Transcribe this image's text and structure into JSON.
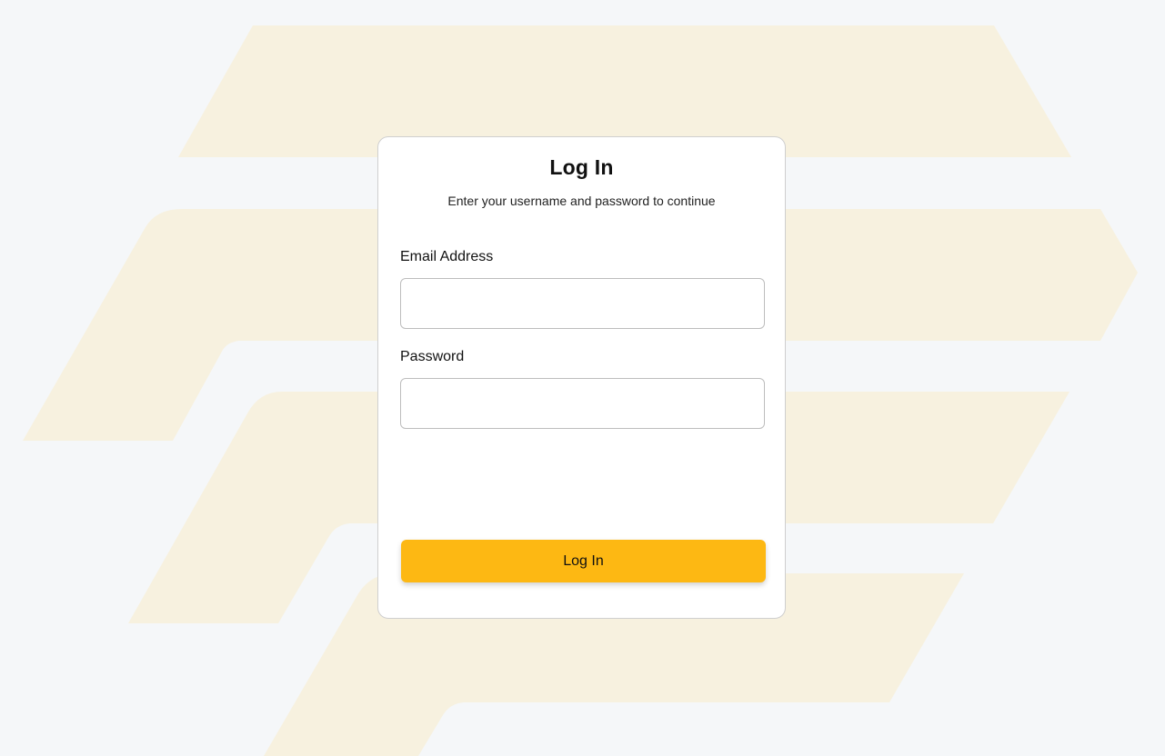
{
  "colors": {
    "page_background": "#f5f7f9",
    "logo_shape": "#f7f1df",
    "accent": "#fdb813"
  },
  "background": {
    "logo_icon": "brand-stripes-logo"
  },
  "login": {
    "title": "Log In",
    "subtitle": "Enter your username and password to continue",
    "email_label": "Email Address",
    "email_value": "",
    "password_label": "Password",
    "password_value": "",
    "submit_label": "Log In"
  }
}
